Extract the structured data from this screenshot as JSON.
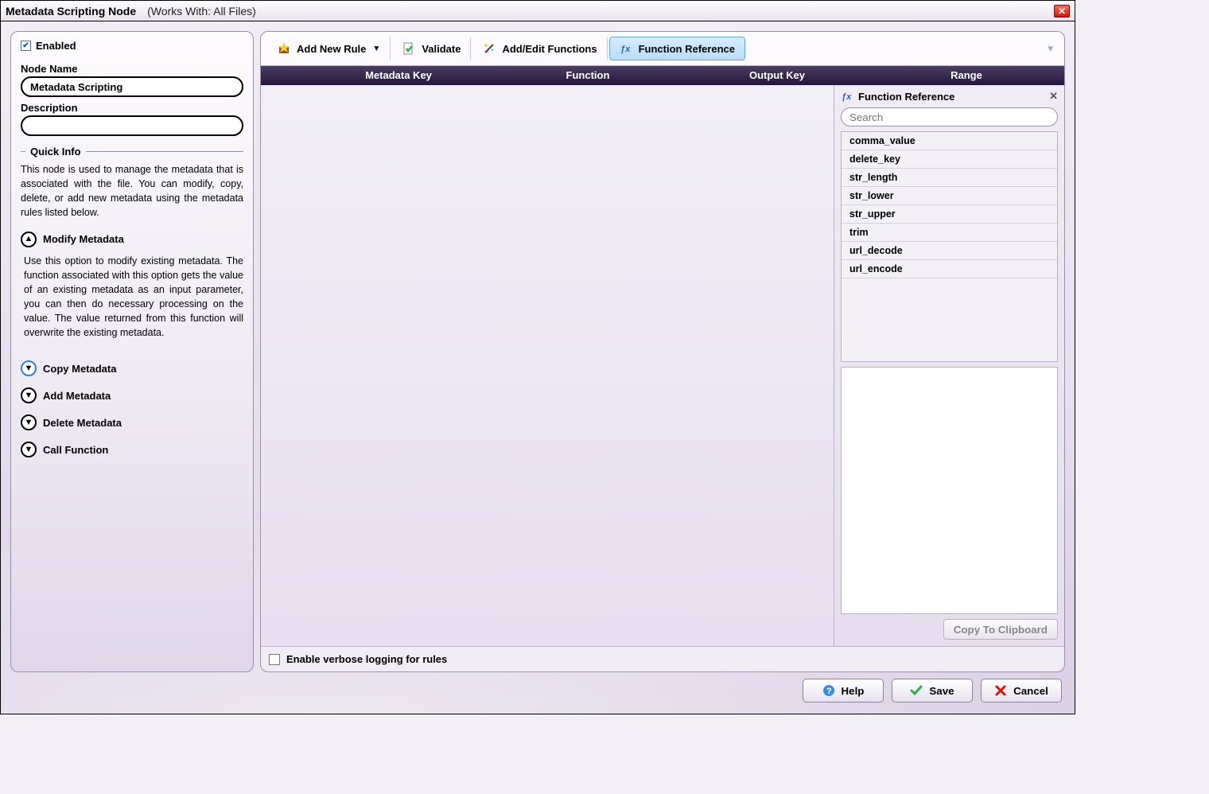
{
  "window": {
    "title": "Metadata Scripting Node",
    "subtitle": "(Works With: All Files)"
  },
  "left": {
    "enabled_label": "Enabled",
    "enabled_checked": true,
    "node_name_label": "Node Name",
    "node_name_value": "Metadata Scripting",
    "description_label": "Description",
    "description_value": "",
    "quick_info_title": "Quick Info",
    "quick_info_text": "This node is used to manage the metadata that is associated with the file. You can modify, copy, delete, or add new metadata using the metadata rules listed below.",
    "accordion": {
      "modify": {
        "label": "Modify Metadata",
        "body": "Use this option to modify existing metadata. The function associated with this option gets the value of an existing metadata as an input parameter, you can then do necessary processing on the value. The value returned from this function will overwrite the existing metadata."
      },
      "copy": {
        "label": "Copy Metadata"
      },
      "add": {
        "label": "Add Metadata"
      },
      "delete": {
        "label": "Delete Metadata"
      },
      "call": {
        "label": "Call Function"
      }
    }
  },
  "toolbar": {
    "add_rule": "Add New Rule",
    "validate": "Validate",
    "addedit_functions": "Add/Edit Functions",
    "function_reference": "Function Reference"
  },
  "table": {
    "cols": [
      "",
      "Metadata Key",
      "Function",
      "Output Key",
      "Range"
    ]
  },
  "function_reference": {
    "title": "Function Reference",
    "search_placeholder": "Search",
    "functions": [
      "comma_value",
      "delete_key",
      "str_length",
      "str_lower",
      "str_upper",
      "trim",
      "url_decode",
      "url_encode"
    ],
    "copy_button": "Copy To Clipboard"
  },
  "verbose_label": "Enable verbose logging for rules",
  "buttons": {
    "help": "Help",
    "save": "Save",
    "cancel": "Cancel"
  }
}
